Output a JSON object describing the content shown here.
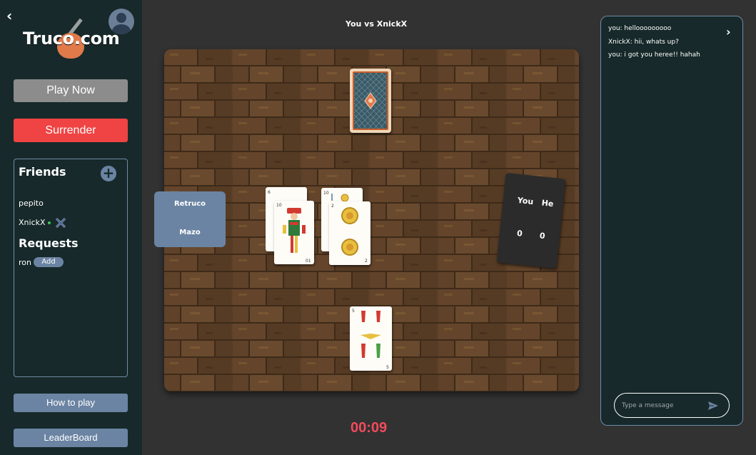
{
  "sidebar": {
    "back_glyph": "‹",
    "logo_text": "Truco.com",
    "play_now": "Play Now",
    "surrender": "Surrender",
    "friends_title": "Friends",
    "add_glyph": "+",
    "friends": [
      {
        "name": "pepito",
        "online": false
      },
      {
        "name": "XnickX",
        "online": true
      }
    ],
    "requests_title": "Requests",
    "requests": [
      {
        "name": "ron",
        "action": "Add"
      }
    ],
    "how_to_play": "How to play",
    "leaderboard": "LeaderBoard"
  },
  "match": {
    "title": "You vs XnickX",
    "timer": "00:09",
    "actions": [
      "Retruco",
      "Mazo"
    ],
    "score": {
      "you_label": "You",
      "he_label": "He",
      "you": "0",
      "he": "0"
    },
    "played_cards": [
      {
        "rank": "10",
        "suit": "copas"
      },
      {
        "rank": "2",
        "suit": "oros"
      }
    ],
    "hand_cards": [
      {
        "rank": "5",
        "suit": "copas"
      }
    ]
  },
  "chat": {
    "close_glyph": "›",
    "messages": [
      "you: hellooooooooo",
      "XnickX: hii, whats up?",
      "you: i got you heree!! hahah"
    ],
    "placeholder": "Type a message"
  },
  "colors": {
    "sidebar_bg": "#17292a",
    "accent_blue": "#6b84a3",
    "surrender_red": "#f04343",
    "timer_red": "#f04b5b",
    "board_wood": "#5b3f27"
  },
  "icons": {
    "back": "chevron-left-icon",
    "avatar": "user-avatar-icon",
    "add_friend": "plus-circle-icon",
    "challenge": "crossed-swords-icon",
    "chat_close": "chevron-right-icon",
    "send": "send-icon"
  }
}
